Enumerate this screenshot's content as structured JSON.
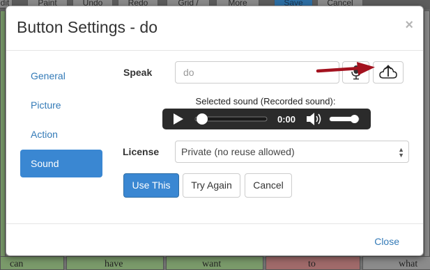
{
  "background": {
    "top_buttons": [
      "dit",
      "Paint",
      "Undo",
      "Redo",
      "Grid /",
      "More",
      "Save",
      "Cancel"
    ],
    "bottom_words": [
      "can",
      "have",
      "want",
      "to",
      "what"
    ]
  },
  "modal": {
    "title": "Button Settings - do",
    "close_symbol": "×",
    "nav": [
      {
        "label": "General",
        "active": false
      },
      {
        "label": "Picture",
        "active": false
      },
      {
        "label": "Action",
        "active": false
      },
      {
        "label": "Sound",
        "active": true
      }
    ],
    "speak": {
      "label": "Speak",
      "value": "do",
      "mic_icon": "microphone-icon",
      "upload_icon": "cloud-upload-icon"
    },
    "sound": {
      "caption": "Selected sound (Recorded sound):",
      "time": "0:00",
      "progress": 0,
      "volume": 0.85
    },
    "license": {
      "label": "License",
      "selected": "Private (no reuse allowed)"
    },
    "buttons": {
      "use_this": "Use This",
      "try_again": "Try Again",
      "cancel": "Cancel"
    },
    "footer": {
      "close": "Close"
    }
  },
  "colors": {
    "accent": "#3a87d2",
    "link": "#337ab7",
    "annotation_arrow": "#a3121f"
  }
}
